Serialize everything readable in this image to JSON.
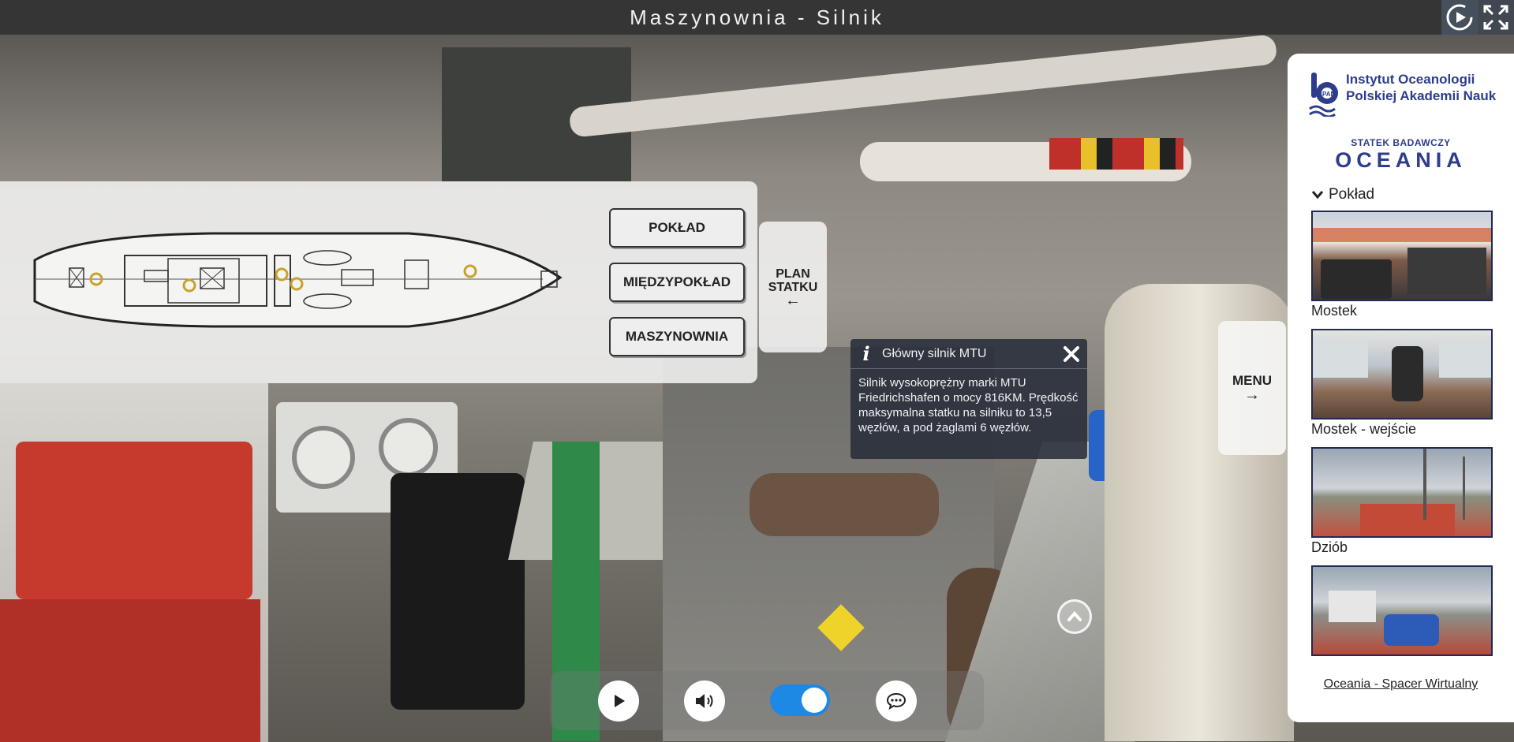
{
  "header": {
    "title": "Maszynownia - Silnik",
    "icons": [
      "autoplay-icon",
      "fullscreen-icon"
    ]
  },
  "plan": {
    "toggle_line1": "PLAN",
    "toggle_line2": "STATKU",
    "toggle_arrow": "←",
    "buttons": [
      "POKŁAD",
      "MIĘDZYPOKŁAD",
      "MASZYNOWNIA"
    ],
    "hotspot_color": "#c8a22c"
  },
  "info": {
    "icon": "i",
    "title": "Główny silnik MTU",
    "body": "Silnik wysokoprężny marki MTU Friedrichshafen o mocy 816KM. Prędkość maksymalna statku na silniku to 13,5 węzłów, a pod żaglami 6 węzłów."
  },
  "menu": {
    "label": "MENU",
    "arrow": "→"
  },
  "sidebar": {
    "logo_line1": "Instytut Oceanologii",
    "logo_line2": "Polskiej Akademii Nauk",
    "logo_badge": "PAN",
    "ship_subtitle": "STATEK BADAWCZY",
    "ship_name": "OCEANIA",
    "section": "Pokład",
    "items": [
      {
        "label": "Mostek"
      },
      {
        "label": "Mostek - wejście"
      },
      {
        "label": "Dziób"
      },
      {
        "label": ""
      }
    ],
    "footer_link": "Oceania - Spacer Wirtualny",
    "brand_color": "#2d3d8c"
  },
  "controls": {
    "icons": [
      "play-icon",
      "volume-icon",
      "toggle-switch",
      "chat-icon"
    ],
    "toggle_on": true,
    "accent": "#1e88e5"
  }
}
